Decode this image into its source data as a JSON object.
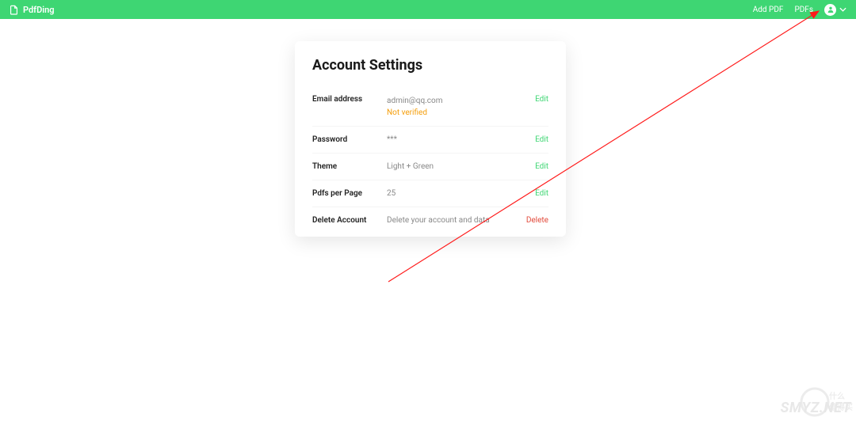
{
  "header": {
    "brand": "PdfDing",
    "nav": {
      "add_pdf": "Add PDF",
      "pdfs": "PDFs"
    }
  },
  "settings": {
    "title": "Account Settings",
    "rows": {
      "email": {
        "label": "Email address",
        "value": "admin@qq.com",
        "verified_text": "Not verified",
        "action": "Edit"
      },
      "password": {
        "label": "Password",
        "value": "***",
        "action": "Edit"
      },
      "theme": {
        "label": "Theme",
        "value": "Light + Green",
        "action": "Edit"
      },
      "pdfs_per_page": {
        "label": "Pdfs per Page",
        "value": "25",
        "action": "Edit"
      },
      "delete_account": {
        "label": "Delete Account",
        "value": "Delete your account and data",
        "action": "Delete"
      }
    }
  },
  "watermark": {
    "text": "SMYZ.NET"
  }
}
